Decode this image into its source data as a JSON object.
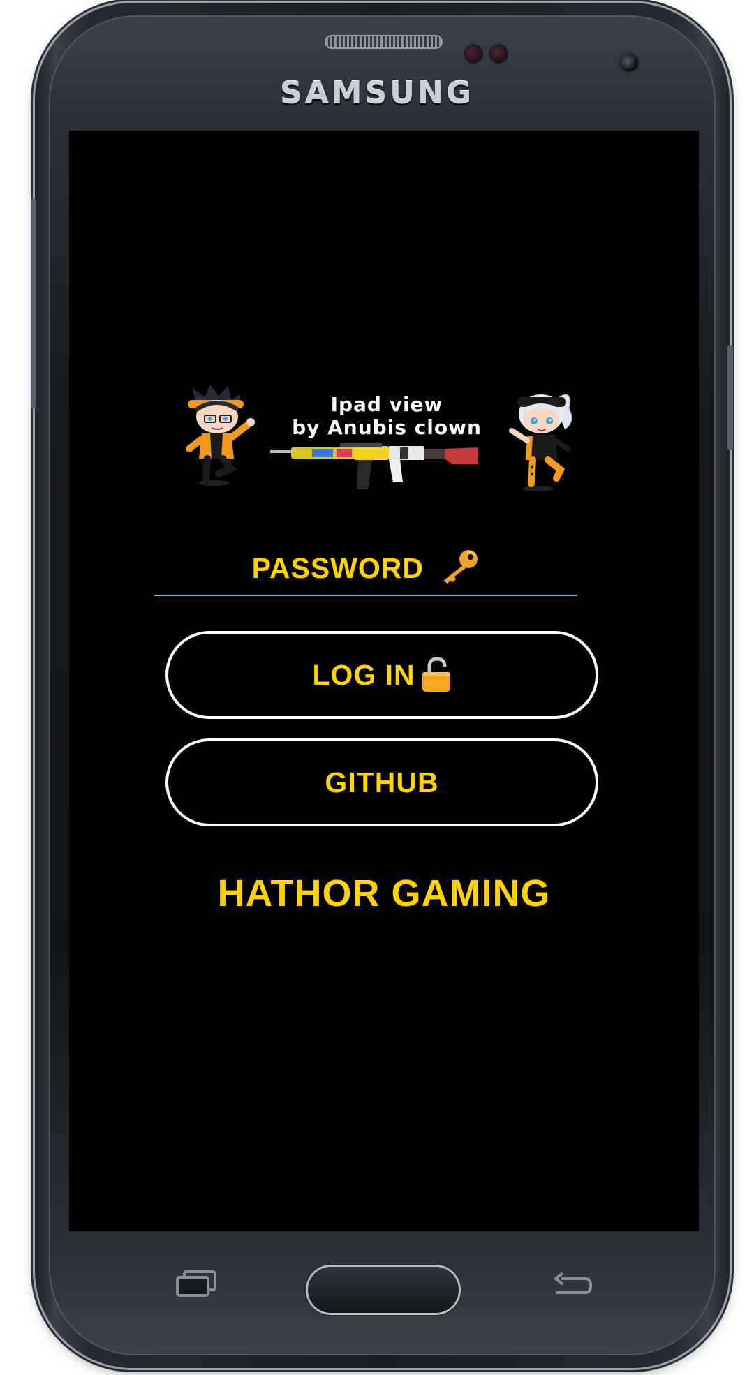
{
  "device": {
    "brand": "SAMSUNG"
  },
  "banner": {
    "line1": "Ipad view",
    "line2": "by Anubis clown"
  },
  "login_form": {
    "password_placeholder": "PASSWORD",
    "password_icon": "key-icon",
    "login_label": "LOG IN",
    "login_icon": "open-lock-icon",
    "github_label": "GITHUB"
  },
  "app": {
    "title": "HATHOR GAMING"
  },
  "colors": {
    "screen_background": "#000000",
    "accent_text": "#ffd300",
    "input_underline": "#58b4d8",
    "button_border": "#ffffff"
  },
  "hardware_keys": [
    "recent-apps-key",
    "home-key",
    "back-key"
  ]
}
